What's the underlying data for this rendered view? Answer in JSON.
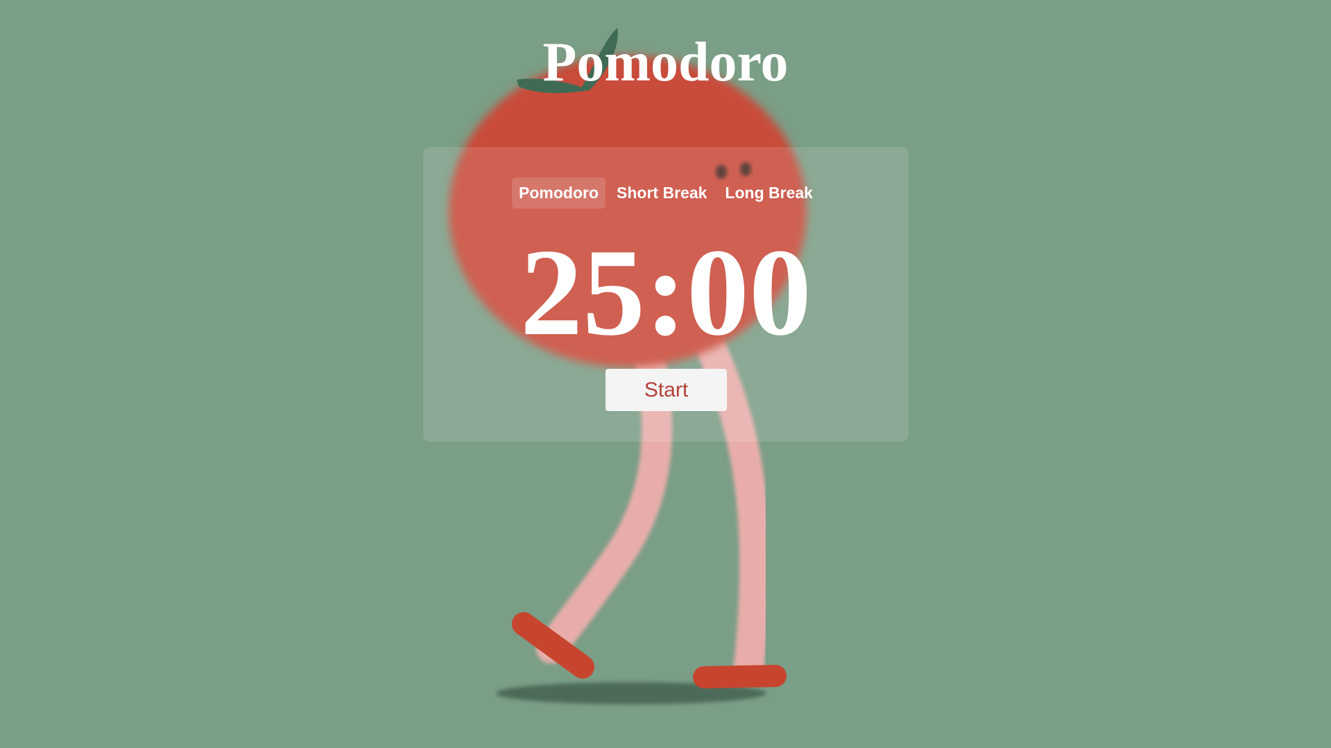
{
  "app": {
    "title": "Pomodoro"
  },
  "tabs": [
    {
      "label": "Pomodoro",
      "active": true
    },
    {
      "label": "Short Break",
      "active": false
    },
    {
      "label": "Long Break",
      "active": false
    }
  ],
  "timer": {
    "display": "25:00"
  },
  "controls": {
    "start_label": "Start"
  },
  "colors": {
    "background": "#7b9e86",
    "tomato": "#c94c3a",
    "legs": "#e8adab",
    "shoes": "#c7452f",
    "shadow": "#4d6a58",
    "start_text": "#b5403a"
  }
}
